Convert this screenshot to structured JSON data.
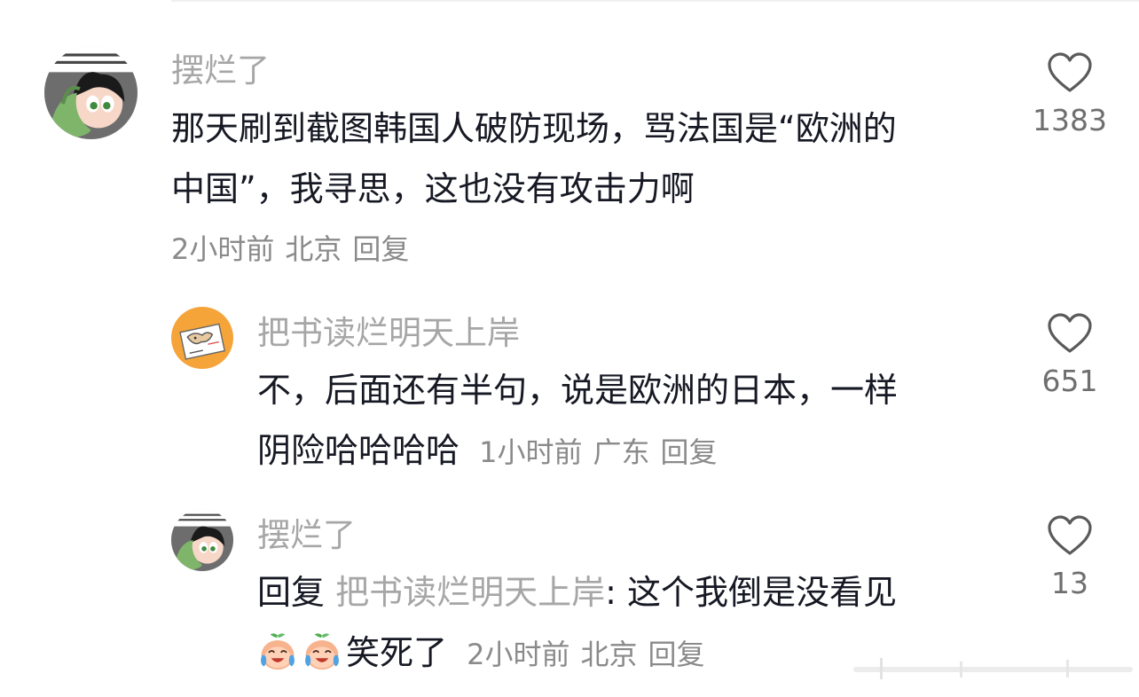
{
  "comments": [
    {
      "username": "摆烂了",
      "text_line1": "那天刷到截图韩国人破防现场，骂法国是“欧洲的",
      "text_line2": "中国”，我寻思，这也没有攻击力啊",
      "time": "2小时前",
      "location": "北京",
      "reply_label": "回复",
      "likes": "1383",
      "avatar_icon": "buttercup-avatar-icon"
    },
    {
      "username": "把书读烂明天上岸",
      "text_line1": "不，后面还有半句，说是欧洲的日本，一样",
      "text_line2": "阴险哈哈哈哈",
      "time": "1小时前",
      "location": "广东",
      "reply_label": "回复",
      "likes": "651",
      "avatar_icon": "paper-doodle-avatar-icon"
    },
    {
      "username": "摆烂了",
      "reply_prefix": "回复",
      "reply_to": "把书读烂明天上岸",
      "text_line1_after": ": 这个我倒是没看见",
      "text_line2": "笑死了",
      "time": "2小时前",
      "location": "北京",
      "reply_label": "回复",
      "likes": "13",
      "avatar_icon": "buttercup-avatar-icon",
      "emojis": [
        "crying-laughing-peach-icon",
        "crying-laughing-peach-icon"
      ]
    }
  ],
  "colors": {
    "text": "#161823",
    "muted": "#a6a6a6",
    "meta": "#8a8a8a"
  }
}
